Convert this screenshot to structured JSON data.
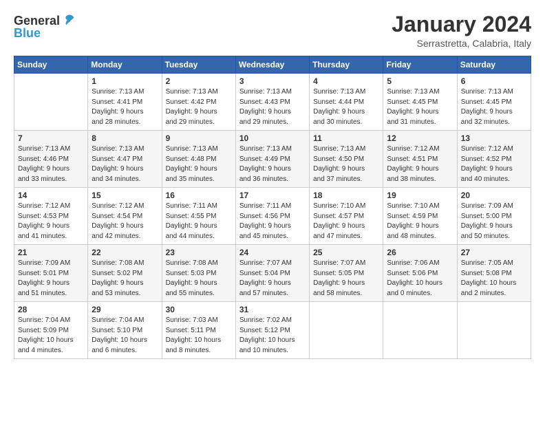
{
  "header": {
    "logo": {
      "general": "General",
      "blue": "Blue"
    },
    "title": "January 2024",
    "location": "Serrastretta, Calabria, Italy"
  },
  "days_of_week": [
    "Sunday",
    "Monday",
    "Tuesday",
    "Wednesday",
    "Thursday",
    "Friday",
    "Saturday"
  ],
  "weeks": [
    [
      {
        "day": "",
        "info": ""
      },
      {
        "day": "1",
        "info": "Sunrise: 7:13 AM\nSunset: 4:41 PM\nDaylight: 9 hours\nand 28 minutes."
      },
      {
        "day": "2",
        "info": "Sunrise: 7:13 AM\nSunset: 4:42 PM\nDaylight: 9 hours\nand 29 minutes."
      },
      {
        "day": "3",
        "info": "Sunrise: 7:13 AM\nSunset: 4:43 PM\nDaylight: 9 hours\nand 29 minutes."
      },
      {
        "day": "4",
        "info": "Sunrise: 7:13 AM\nSunset: 4:44 PM\nDaylight: 9 hours\nand 30 minutes."
      },
      {
        "day": "5",
        "info": "Sunrise: 7:13 AM\nSunset: 4:45 PM\nDaylight: 9 hours\nand 31 minutes."
      },
      {
        "day": "6",
        "info": "Sunrise: 7:13 AM\nSunset: 4:45 PM\nDaylight: 9 hours\nand 32 minutes."
      }
    ],
    [
      {
        "day": "7",
        "info": "Sunrise: 7:13 AM\nSunset: 4:46 PM\nDaylight: 9 hours\nand 33 minutes."
      },
      {
        "day": "8",
        "info": "Sunrise: 7:13 AM\nSunset: 4:47 PM\nDaylight: 9 hours\nand 34 minutes."
      },
      {
        "day": "9",
        "info": "Sunrise: 7:13 AM\nSunset: 4:48 PM\nDaylight: 9 hours\nand 35 minutes."
      },
      {
        "day": "10",
        "info": "Sunrise: 7:13 AM\nSunset: 4:49 PM\nDaylight: 9 hours\nand 36 minutes."
      },
      {
        "day": "11",
        "info": "Sunrise: 7:13 AM\nSunset: 4:50 PM\nDaylight: 9 hours\nand 37 minutes."
      },
      {
        "day": "12",
        "info": "Sunrise: 7:12 AM\nSunset: 4:51 PM\nDaylight: 9 hours\nand 38 minutes."
      },
      {
        "day": "13",
        "info": "Sunrise: 7:12 AM\nSunset: 4:52 PM\nDaylight: 9 hours\nand 40 minutes."
      }
    ],
    [
      {
        "day": "14",
        "info": "Sunrise: 7:12 AM\nSunset: 4:53 PM\nDaylight: 9 hours\nand 41 minutes."
      },
      {
        "day": "15",
        "info": "Sunrise: 7:12 AM\nSunset: 4:54 PM\nDaylight: 9 hours\nand 42 minutes."
      },
      {
        "day": "16",
        "info": "Sunrise: 7:11 AM\nSunset: 4:55 PM\nDaylight: 9 hours\nand 44 minutes."
      },
      {
        "day": "17",
        "info": "Sunrise: 7:11 AM\nSunset: 4:56 PM\nDaylight: 9 hours\nand 45 minutes."
      },
      {
        "day": "18",
        "info": "Sunrise: 7:10 AM\nSunset: 4:57 PM\nDaylight: 9 hours\nand 47 minutes."
      },
      {
        "day": "19",
        "info": "Sunrise: 7:10 AM\nSunset: 4:59 PM\nDaylight: 9 hours\nand 48 minutes."
      },
      {
        "day": "20",
        "info": "Sunrise: 7:09 AM\nSunset: 5:00 PM\nDaylight: 9 hours\nand 50 minutes."
      }
    ],
    [
      {
        "day": "21",
        "info": "Sunrise: 7:09 AM\nSunset: 5:01 PM\nDaylight: 9 hours\nand 51 minutes."
      },
      {
        "day": "22",
        "info": "Sunrise: 7:08 AM\nSunset: 5:02 PM\nDaylight: 9 hours\nand 53 minutes."
      },
      {
        "day": "23",
        "info": "Sunrise: 7:08 AM\nSunset: 5:03 PM\nDaylight: 9 hours\nand 55 minutes."
      },
      {
        "day": "24",
        "info": "Sunrise: 7:07 AM\nSunset: 5:04 PM\nDaylight: 9 hours\nand 57 minutes."
      },
      {
        "day": "25",
        "info": "Sunrise: 7:07 AM\nSunset: 5:05 PM\nDaylight: 9 hours\nand 58 minutes."
      },
      {
        "day": "26",
        "info": "Sunrise: 7:06 AM\nSunset: 5:06 PM\nDaylight: 10 hours\nand 0 minutes."
      },
      {
        "day": "27",
        "info": "Sunrise: 7:05 AM\nSunset: 5:08 PM\nDaylight: 10 hours\nand 2 minutes."
      }
    ],
    [
      {
        "day": "28",
        "info": "Sunrise: 7:04 AM\nSunset: 5:09 PM\nDaylight: 10 hours\nand 4 minutes."
      },
      {
        "day": "29",
        "info": "Sunrise: 7:04 AM\nSunset: 5:10 PM\nDaylight: 10 hours\nand 6 minutes."
      },
      {
        "day": "30",
        "info": "Sunrise: 7:03 AM\nSunset: 5:11 PM\nDaylight: 10 hours\nand 8 minutes."
      },
      {
        "day": "31",
        "info": "Sunrise: 7:02 AM\nSunset: 5:12 PM\nDaylight: 10 hours\nand 10 minutes."
      },
      {
        "day": "",
        "info": ""
      },
      {
        "day": "",
        "info": ""
      },
      {
        "day": "",
        "info": ""
      }
    ]
  ]
}
